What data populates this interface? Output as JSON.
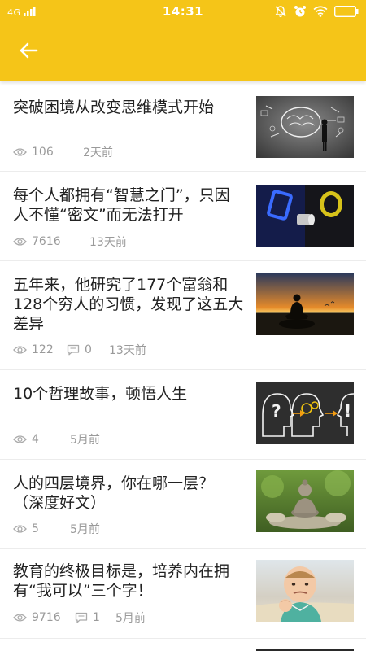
{
  "status_bar": {
    "network": "4G",
    "time": "14:31"
  },
  "header": {
    "back_icon": "arrow-left-icon"
  },
  "articles": [
    {
      "title": "突破困境从改变思维模式开始",
      "views": "106",
      "comments": null,
      "time": "2天前",
      "thumb": "brain-chalkboard"
    },
    {
      "title": "每个人都拥有“智慧之门”，只因人不懂“密文”而无法打开",
      "views": "7616",
      "comments": null,
      "time": "13天前",
      "thumb": "doorway-light"
    },
    {
      "title": "五年来，他研究了177个富翁和128个穷人的习惯，发现了这五大差异",
      "views": "122",
      "comments": "0",
      "time": "13天前",
      "thumb": "meditation-sunset"
    },
    {
      "title": "10个哲理故事，顿悟人生",
      "views": "4",
      "comments": null,
      "time": "5月前",
      "thumb": "heads-chalkboard"
    },
    {
      "title": "人的四层境界，你在哪一层？（深度好文）",
      "views": "5",
      "comments": null,
      "time": "5月前",
      "thumb": "buddha-statue"
    },
    {
      "title": "教育的终极目标是，培养内在拥有“我可以”三个字！",
      "views": "9716",
      "comments": "1",
      "time": "5月前",
      "thumb": "success-baby"
    }
  ]
}
